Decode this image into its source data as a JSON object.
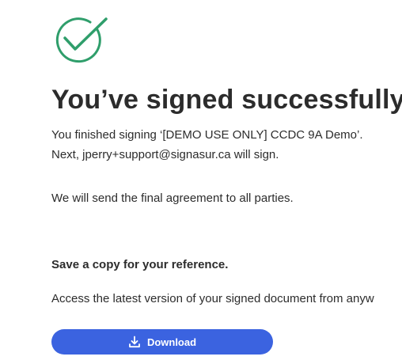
{
  "success_icon": "check-circle-icon",
  "colors": {
    "success": "#2f9e6b",
    "accent": "#3b63e0"
  },
  "heading": "You’ve signed successfully.",
  "message": {
    "line1": "You finished signing ‘[DEMO USE ONLY] CCDC 9A Demo’.",
    "line2": "Next, jperry+support@signasur.ca will sign.",
    "line3": "We will send the final agreement to all parties."
  },
  "save_section": {
    "title": "Save a copy for your reference.",
    "description": "Access the latest version of your signed document from anyw"
  },
  "download_button": {
    "label": "Download",
    "icon": "download-icon"
  }
}
